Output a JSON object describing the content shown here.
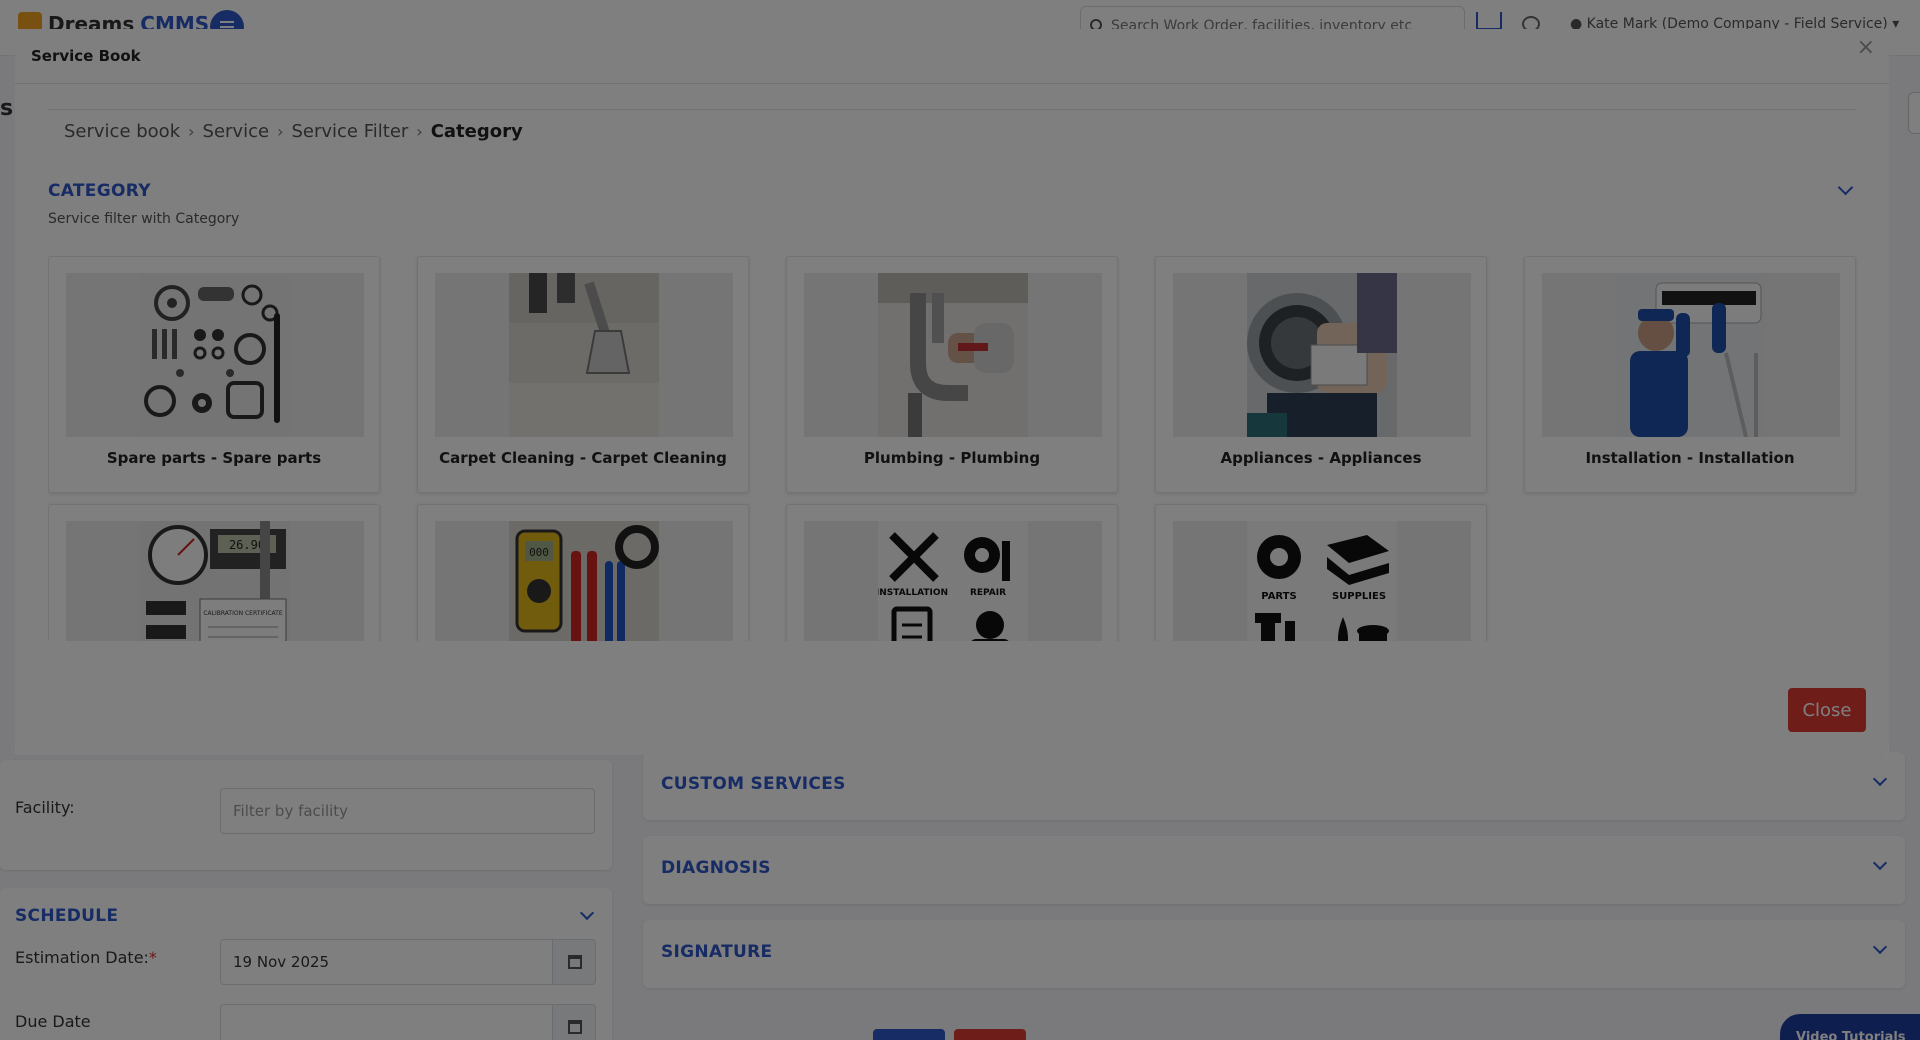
{
  "app": {
    "logo_text": "Dreams",
    "logo_accent": "CMMS",
    "search_placeholder": "Search Work Order, facilities, inventory etc",
    "user": "Kate Mark (Demo Company - Field Service)"
  },
  "form": {
    "facility_label": "Facility:",
    "facility_placeholder": "Filter by facility",
    "schedule_title": "SCHEDULE",
    "estimation_label": "Estimation Date:",
    "estimation_required": "*",
    "estimation_value": "19 Nov 2025",
    "due_label": "Due Date"
  },
  "sections": {
    "custom_services": "CUSTOM SERVICES",
    "diagnosis": "DIAGNOSIS",
    "signature": "SIGNATURE"
  },
  "video_tutorials": "Video Tutorials",
  "modal": {
    "title": "Service Book",
    "close_x": "×",
    "breadcrumbs": [
      "Service book",
      "Service",
      "Service Filter",
      "Category"
    ],
    "category_title": "CATEGORY",
    "category_subtitle": "Service filter with Category",
    "close_label": "Close"
  },
  "categories": [
    {
      "label": "Spare parts - Spare parts",
      "icon": "spare-parts-photo"
    },
    {
      "label": "Carpet Cleaning - Carpet Cleaning",
      "icon": "carpet-cleaning-photo"
    },
    {
      "label": "Plumbing - Plumbing",
      "icon": "plumbing-photo"
    },
    {
      "label": "Appliances - Appliances",
      "icon": "appliances-photo"
    },
    {
      "label": "Installation - Installation",
      "icon": "installation-photo"
    },
    {
      "label": "",
      "icon": "calibration-photo"
    },
    {
      "label": "",
      "icon": "electrical-tools-photo"
    },
    {
      "label": "",
      "icon": "installation-repair-icons",
      "text1": "INSTALLATION",
      "text2": "REPAIR"
    },
    {
      "label": "",
      "icon": "parts-supplies-icons",
      "text1": "PARTS",
      "text2": "SUPPLIES"
    }
  ],
  "image_text": {
    "gauge_reading": "26.90",
    "certificate": "CALIBRATION CERTIFICATE",
    "multimeter": "000"
  },
  "colors": {
    "accent": "#2e57c9",
    "danger": "#dc3b33",
    "overlay": "rgba(0,0,0,0.5)"
  }
}
